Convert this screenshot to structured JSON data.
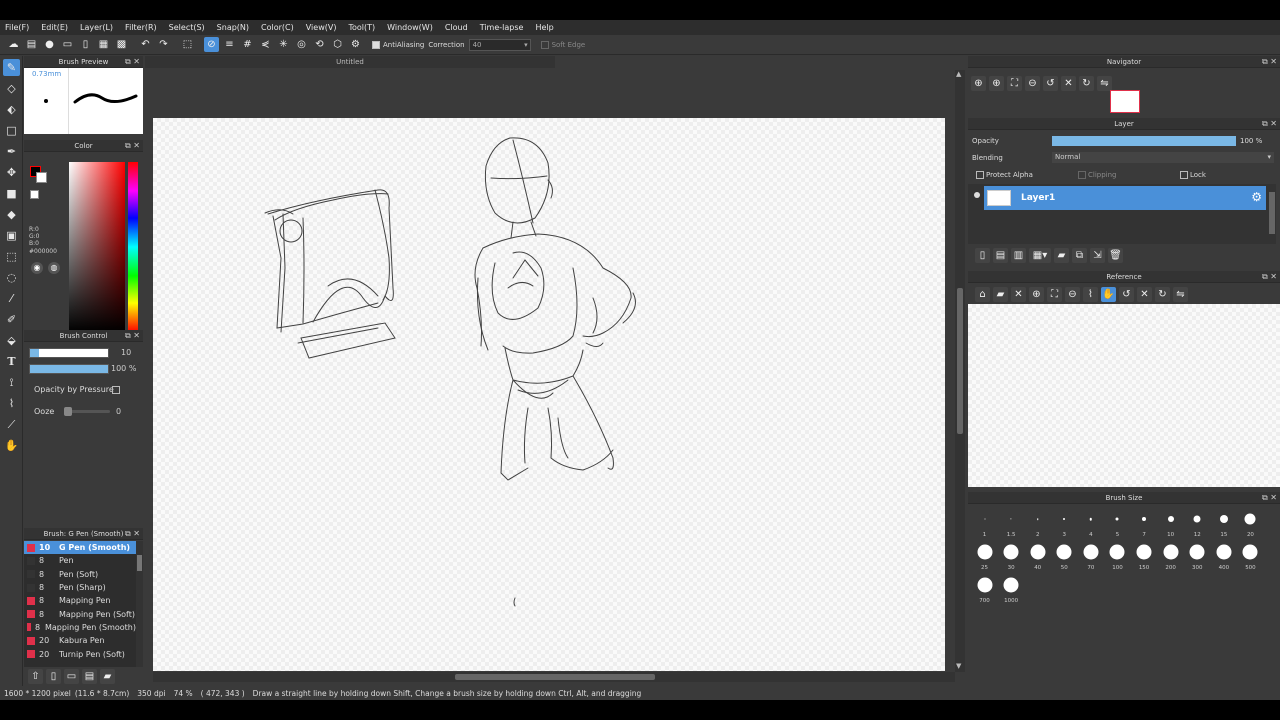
{
  "menubar": {
    "items": [
      "File(F)",
      "Edit(E)",
      "Layer(L)",
      "Filter(R)",
      "Select(S)",
      "Snap(N)",
      "Color(C)",
      "View(V)",
      "Tool(T)",
      "Window(W)",
      "Cloud",
      "Time-lapse",
      "Help"
    ]
  },
  "toolbar": {
    "antialiasing_label": "AntiAliasing",
    "correction_label": "Correction",
    "correction_value": "40",
    "soft_edge_label": "Soft Edge"
  },
  "brush_preview": {
    "title": "Brush Preview",
    "size": "0.73mm"
  },
  "color_panel": {
    "title": "Color",
    "r": "R:0",
    "g": "G:0",
    "b": "B:0",
    "hex": "#000000",
    "foreground": "#000000",
    "background": "#ffffff"
  },
  "brush_control": {
    "title": "Brush Control",
    "size_value": "10",
    "size_fill": 0.12,
    "opacity_value": "100 %",
    "opacity_fill": 1.0,
    "opacity_by_pressure_label": "Opacity by Pressure",
    "ooze_label": "Ooze",
    "ooze_value": "0"
  },
  "brush_list": {
    "title": "Brush: G Pen (Smooth)",
    "items": [
      {
        "size": "10",
        "name": "G Pen (Smooth)",
        "red": true,
        "selected": true
      },
      {
        "size": "8",
        "name": "Pen",
        "red": false,
        "selected": false
      },
      {
        "size": "8",
        "name": "Pen (Soft)",
        "red": false,
        "selected": false
      },
      {
        "size": "8",
        "name": "Pen (Sharp)",
        "red": false,
        "selected": false
      },
      {
        "size": "8",
        "name": "Mapping Pen",
        "red": true,
        "selected": false
      },
      {
        "size": "8",
        "name": "Mapping Pen (Soft)",
        "red": true,
        "selected": false
      },
      {
        "size": "8",
        "name": "Mapping Pen (Smooth)",
        "red": true,
        "selected": false
      },
      {
        "size": "20",
        "name": "Kabura Pen",
        "red": true,
        "selected": false
      },
      {
        "size": "20",
        "name": "Turnip Pen (Soft)",
        "red": true,
        "selected": false
      }
    ]
  },
  "document": {
    "tab_title": "Untitled"
  },
  "navigator": {
    "title": "Navigator"
  },
  "layer_panel": {
    "title": "Layer",
    "opacity_label": "Opacity",
    "opacity_value": "100 %",
    "opacity_fill": 1.0,
    "blending_label": "Blending",
    "blending_value": "Normal",
    "protect_alpha_label": "Protect Alpha",
    "clipping_label": "Clipping",
    "lock_label": "Lock",
    "layer_name": "Layer1"
  },
  "reference": {
    "title": "Reference"
  },
  "brush_size": {
    "title": "Brush Size",
    "sizes": [
      "1",
      "1.5",
      "2",
      "3",
      "4",
      "5",
      "7",
      "10",
      "12",
      "15",
      "20",
      "25",
      "30",
      "40",
      "50",
      "70",
      "100",
      "150",
      "200",
      "300",
      "400",
      "500",
      "700",
      "1000"
    ]
  },
  "status": {
    "dimensions": "1600 * 1200 pixel",
    "physical": "(11.6 * 8.7cm)",
    "dpi": "350 dpi",
    "zoom": "74 %",
    "cursor": "( 472, 343 )",
    "hint": "Draw a straight line by holding down Shift, Change a brush size by holding down Ctrl, Alt, and dragging"
  },
  "colors": {
    "accent": "#4a90d9",
    "panel_bg": "#3a3a3a"
  }
}
